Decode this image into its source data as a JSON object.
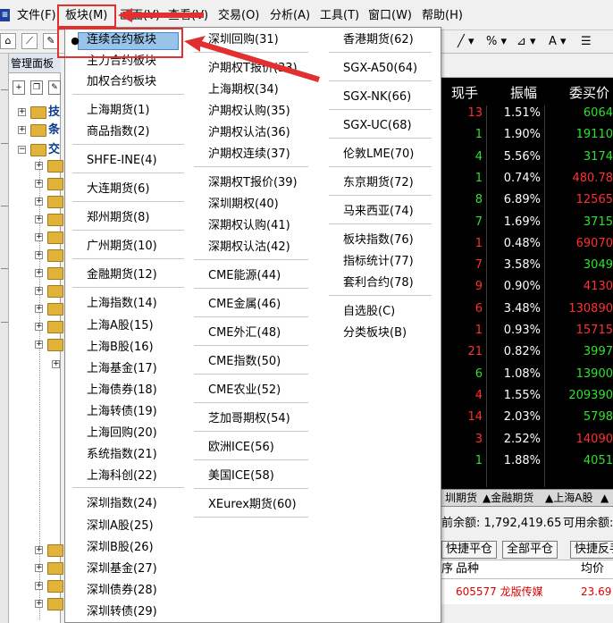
{
  "menubar": {
    "items": [
      "文件(F)",
      "板块(M)",
      "画面(V)",
      "查看(V)",
      "交易(O)",
      "分析(A)",
      "工具(T)",
      "窗口(W)",
      "帮助(H)"
    ]
  },
  "toolbar": {
    "right_glyphs": [
      "╱ ▾",
      "% ▾",
      "⊿ ▾",
      "A ▾",
      "☰"
    ]
  },
  "left_panel": {
    "title": "管理面板",
    "tree": [
      {
        "label": "技"
      },
      {
        "label": "条"
      },
      {
        "label": "交"
      }
    ]
  },
  "dropdown": {
    "highlighted": "连续合约板块",
    "col1": [
      "连续合约板块",
      "主力合约板块",
      "加权合约板块",
      "上海期货(1)",
      "商品指数(2)",
      "SHFE-INE(4)",
      "大连期货(6)",
      "郑州期货(8)",
      "广州期货(10)",
      "金融期货(12)",
      "上海指数(14)",
      "上海A股(15)",
      "上海B股(16)",
      "上海基金(17)",
      "上海债券(18)",
      "上海转债(19)",
      "上海回购(20)",
      "系统指数(21)",
      "上海科创(22)",
      "深圳指数(24)",
      "深圳A股(25)",
      "深圳B股(26)",
      "深圳基金(27)",
      "深圳债券(28)",
      "深圳转债(29)"
    ],
    "col2": [
      "深圳回购(31)",
      "沪期权T报价(33)",
      "上海期权(34)",
      "沪期权认购(35)",
      "沪期权认沽(36)",
      "沪期权连续(37)",
      "深期权T报价(39)",
      "深圳期权(40)",
      "深期权认购(41)",
      "深期权认沽(42)",
      "CME能源(44)",
      "CME金属(46)",
      "CME外汇(48)",
      "CME指数(50)",
      "CME农业(52)",
      "芝加哥期权(54)",
      "欧洲ICE(56)",
      "美国ICE(58)",
      "XEurex期货(60)"
    ],
    "col3": [
      "香港期货(62)",
      "SGX-A50(64)",
      "SGX-NK(66)",
      "SGX-UC(68)",
      "伦敦LME(70)",
      "东京期货(72)",
      "马来西亚(74)",
      "板块指数(76)",
      "指标统计(77)",
      "套利合约(78)",
      "自选股(C)",
      "分类板块(B)"
    ]
  },
  "quote": {
    "headers": [
      "现手",
      "振幅",
      "委买价"
    ],
    "rows": [
      {
        "vol": "13",
        "amp": "1.51%",
        "bid": "6064"
      },
      {
        "vol": "1",
        "amp": "1.90%",
        "bid": "19110"
      },
      {
        "vol": "4",
        "amp": "5.56%",
        "bid": "3174"
      },
      {
        "vol": "1",
        "amp": "0.74%",
        "bid": "480.78"
      },
      {
        "vol": "8",
        "amp": "6.89%",
        "bid": "12565"
      },
      {
        "vol": "7",
        "amp": "1.69%",
        "bid": "3715"
      },
      {
        "vol": "1",
        "amp": "0.48%",
        "bid": "69070"
      },
      {
        "vol": "7",
        "amp": "3.58%",
        "bid": "3049"
      },
      {
        "vol": "9",
        "amp": "0.90%",
        "bid": "4130"
      },
      {
        "vol": "6",
        "amp": "3.48%",
        "bid": "130890"
      },
      {
        "vol": "1",
        "amp": "0.93%",
        "bid": "15715"
      },
      {
        "vol": "21",
        "amp": "0.82%",
        "bid": "3997"
      },
      {
        "vol": "6",
        "amp": "1.08%",
        "bid": "13900"
      },
      {
        "vol": "4",
        "amp": "1.55%",
        "bid": "209390"
      },
      {
        "vol": "14",
        "amp": "2.03%",
        "bid": "5798"
      },
      {
        "vol": "3",
        "amp": "2.52%",
        "bid": "14090"
      },
      {
        "vol": "1",
        "amp": "1.88%",
        "bid": "4051"
      }
    ],
    "vol_colors": [
      "#ff3030",
      "#30e030",
      "#30e030",
      "#30e030",
      "#30e030",
      "#30e030",
      "#ff3030",
      "#ff3030",
      "#ff3030",
      "#ff3030",
      "#ff3030",
      "#ff3030",
      "#30e030",
      "#ff3030",
      "#ff3030",
      "#ff3030",
      "#30e030"
    ],
    "bid_colors": [
      "#30e030",
      "#30e030",
      "#30e030",
      "#ff3030",
      "#ff3030",
      "#30e030",
      "#ff3030",
      "#30e030",
      "#ff3030",
      "#ff3030",
      "#ff3030",
      "#30e030",
      "#30e030",
      "#30e030",
      "#30e030",
      "#ff3030",
      "#30e030"
    ]
  },
  "tabs": [
    "圳期货",
    "▲金融期货",
    "▲上海A股",
    "▲"
  ],
  "account": {
    "balance_label": "前余额: 1,792,419.65",
    "available_label": "可用余额:",
    "buttons": [
      "快捷平仓",
      "全部平仓",
      "快捷反手"
    ],
    "order_headers": [
      "序",
      "品种",
      "均价"
    ],
    "order_row": {
      "product": "605577 龙版传媒",
      "price": "23.69"
    }
  },
  "colors": {
    "highlight": "#99c4ea",
    "annotation_red": "#e03030",
    "up_red": "#ff3030",
    "down_green": "#30e030"
  }
}
